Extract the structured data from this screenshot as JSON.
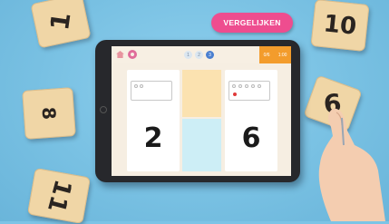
{
  "sticker": {
    "label": "VERGELIJKEN",
    "color": "#ee4d8f"
  },
  "tiles": {
    "top_left": "1",
    "top_right": "10",
    "middle_left": "8",
    "bottom_left": "11",
    "held": "6"
  },
  "app": {
    "progress": [
      "1",
      "2",
      "3"
    ],
    "active_step": "3",
    "score": {
      "left": "0/6",
      "right": "1:00"
    },
    "left_number": "2",
    "right_number": "6",
    "left_dots_filled": 0,
    "right_dots_filled": 1,
    "accent": "#f39c2c"
  }
}
